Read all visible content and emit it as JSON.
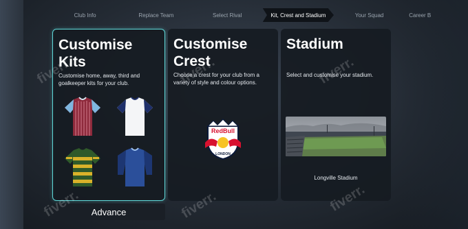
{
  "nav": {
    "steps": [
      "Club Info",
      "Replace Team",
      "Select Rival",
      "Kit, Crest and Stadium",
      "Your Squad",
      "Career B"
    ],
    "active_index": 3
  },
  "cards": {
    "kits": {
      "title": "Customise Kits",
      "description": "Customise home, away, third and goalkeeper kits for your club."
    },
    "crest": {
      "title": "Customise Crest",
      "description": "Choose a crest for your club from a variety of style and colour options.",
      "crest_text": "RedBull",
      "crest_sub": "LONDON"
    },
    "stadium": {
      "title": "Stadium",
      "description": "Select and customise your stadium.",
      "stadium_name": "Longville Stadium"
    }
  },
  "advance_label": "Advance",
  "watermark": "fiverr.",
  "colors": {
    "selected_border": "#5fd8d8",
    "card_bg": "#161b22",
    "text": "#ffffff"
  }
}
